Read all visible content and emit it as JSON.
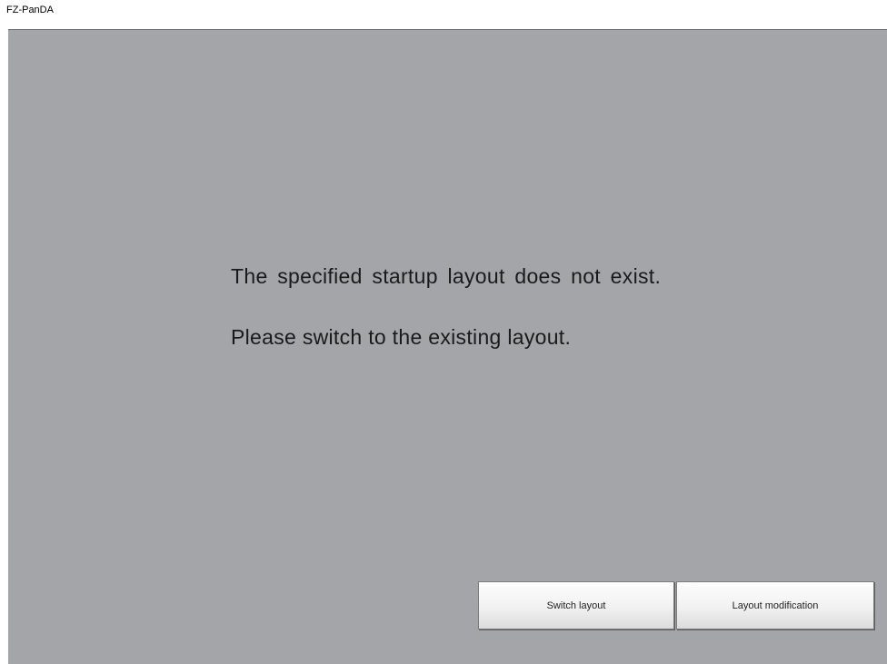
{
  "window": {
    "title": "FZ-PanDA"
  },
  "dialog": {
    "message_line1": "The specified startup layout does not exist.",
    "message_line2": "Please switch to the existing layout."
  },
  "buttons": {
    "switch_layout": "Switch layout",
    "layout_modification": "Layout modification"
  },
  "colors": {
    "panel_background": "#a4a5a8",
    "text": "#1a1a1a"
  }
}
